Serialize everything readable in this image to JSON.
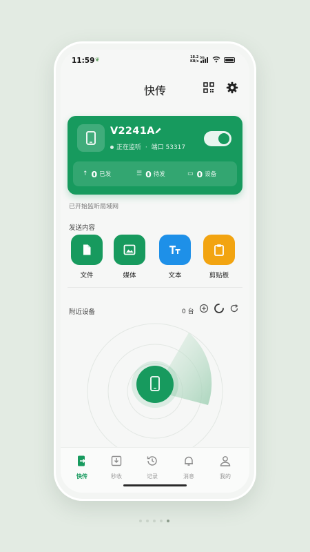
{
  "status_bar": {
    "time": "11:59",
    "net_speed_value": "18.2",
    "net_speed_unit": "KB/s",
    "network": "5G",
    "battery_level": 1.0
  },
  "header": {
    "title": "快传",
    "qr_icon": "qr-code-icon",
    "settings_icon": "gear-icon"
  },
  "device_card": {
    "name": "V2241A",
    "status": "正在监听",
    "separator": "·",
    "port": "端口 53317",
    "toggle_on": true,
    "stats": [
      {
        "icon": "↑",
        "value": "0",
        "label": "已发"
      },
      {
        "icon": "☰",
        "value": "0",
        "label": "待发"
      },
      {
        "icon": "▭",
        "value": "0",
        "label": "设备"
      }
    ]
  },
  "listening_text": "已开始监听局域网",
  "send": {
    "label": "发送内容",
    "items": [
      {
        "label": "文件",
        "color": "#179a5e",
        "icon": "file-icon"
      },
      {
        "label": "媒体",
        "color": "#179a5e",
        "icon": "image-icon"
      },
      {
        "label": "文本",
        "color": "#1e90e8",
        "icon": "text-icon"
      },
      {
        "label": "剪贴板",
        "color": "#f2a411",
        "icon": "clipboard-icon"
      }
    ]
  },
  "nearby": {
    "label": "附近设备",
    "count": "0 台"
  },
  "tabs": [
    {
      "label": "快传",
      "active": true,
      "icon": "transfer-icon"
    },
    {
      "label": "秒收",
      "active": false,
      "icon": "inbox-icon"
    },
    {
      "label": "记录",
      "active": false,
      "icon": "history-icon"
    },
    {
      "label": "消息",
      "active": false,
      "icon": "bell-icon"
    },
    {
      "label": "我的",
      "active": false,
      "icon": "user-icon"
    }
  ],
  "accent_color": "#179a5e",
  "pager": {
    "count": 5,
    "active": 4
  }
}
